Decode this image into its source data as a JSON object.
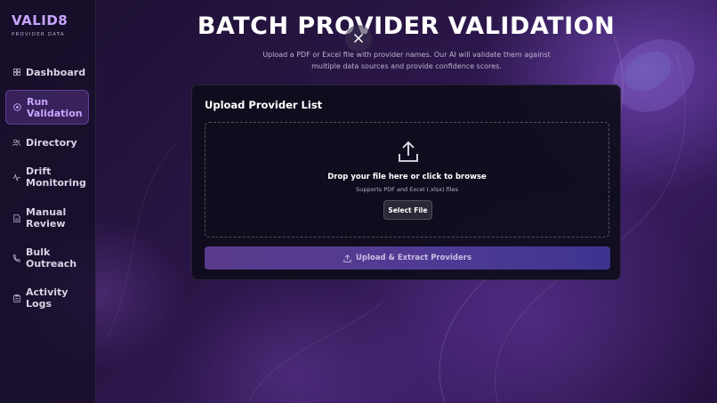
{
  "brand": {
    "title": "VALID8",
    "subtitle": "PROVIDER DATA"
  },
  "sidebar": {
    "items": [
      {
        "label": "Dashboard",
        "icon": "grid-icon",
        "active": false
      },
      {
        "label": "Run Validation",
        "icon": "target-icon",
        "active": true
      },
      {
        "label": "Directory",
        "icon": "users-icon",
        "active": false
      },
      {
        "label": "Drift Monitoring",
        "icon": "activity-icon",
        "active": false
      },
      {
        "label": "Manual Review",
        "icon": "document-icon",
        "active": false
      },
      {
        "label": "Bulk Outreach",
        "icon": "phone-icon",
        "active": false
      },
      {
        "label": "Activity Logs",
        "icon": "clipboard-icon",
        "active": false
      }
    ]
  },
  "header": {
    "title": "BATCH PROVIDER VALIDATION",
    "subtitle": "Upload a PDF or Excel file with provider names. Our AI will validate them against multiple data sources and provide confidence scores."
  },
  "upload": {
    "card_title": "Upload Provider List",
    "drop_title": "Drop your file here or click to browse",
    "drop_sub": "Supports PDF and Excel (.xlsx) files",
    "select_label": "Select File",
    "submit_label": "Upload & Extract Providers"
  },
  "colors": {
    "accent": "#c8a4ff",
    "button_gradient_start": "#5a3c8e",
    "button_gradient_end": "#3d348f"
  }
}
